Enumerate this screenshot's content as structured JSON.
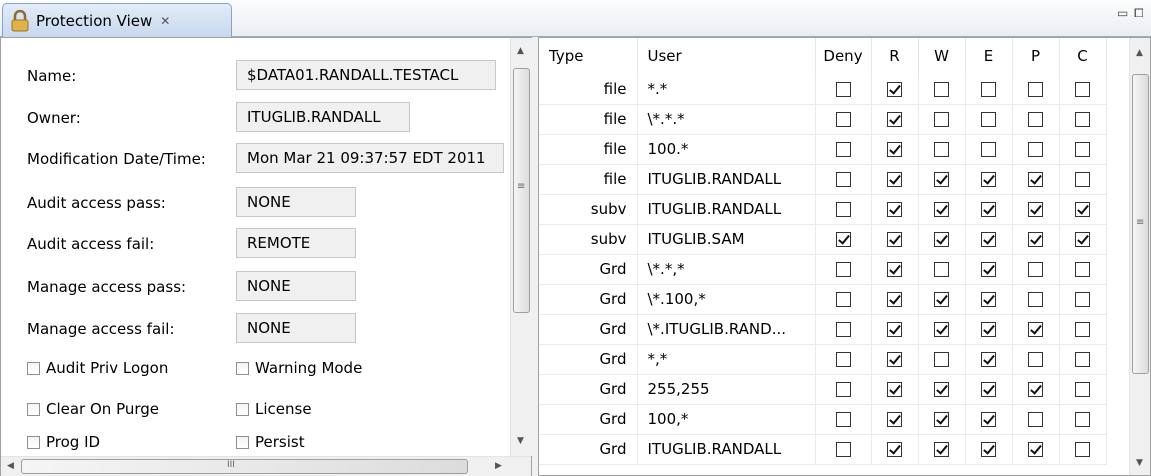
{
  "tab": {
    "title": "Protection View",
    "close": "✕"
  },
  "window_controls": {
    "minimize": "▭",
    "maximize": "⧠"
  },
  "fields": [
    {
      "label": "Name:",
      "value": "$DATA01.RANDALL.TESTACL"
    },
    {
      "label": "Owner:",
      "value": "ITUGLIB.RANDALL"
    },
    {
      "label": "Modification Date/Time:",
      "value": "Mon Mar 21 09:37:57 EDT 2011"
    },
    {
      "label": "Audit access pass:",
      "value": "NONE"
    },
    {
      "label": "Audit access fail:",
      "value": "REMOTE"
    },
    {
      "label": "Manage access pass:",
      "value": "NONE"
    },
    {
      "label": "Manage access fail:",
      "value": "NONE"
    }
  ],
  "options": [
    {
      "label": "Audit Priv Logon",
      "checked": false
    },
    {
      "label": "Warning Mode",
      "checked": false
    },
    {
      "label": "Clear On Purge",
      "checked": false
    },
    {
      "label": "License",
      "checked": false
    },
    {
      "label": "Prog ID",
      "checked": false
    },
    {
      "label": "Persist",
      "checked": false
    }
  ],
  "left_scroll": {
    "hscroll_grip": "III"
  },
  "table": {
    "columns": [
      "Type",
      "User",
      "Deny",
      "R",
      "W",
      "E",
      "P",
      "C"
    ],
    "rows": [
      {
        "type": "file",
        "user": "*.*",
        "flags": [
          0,
          1,
          0,
          0,
          0,
          0
        ]
      },
      {
        "type": "file",
        "user": "\\*.*.*",
        "flags": [
          0,
          1,
          0,
          0,
          0,
          0
        ]
      },
      {
        "type": "file",
        "user": "100.*",
        "flags": [
          0,
          1,
          0,
          0,
          0,
          0
        ]
      },
      {
        "type": "file",
        "user": "ITUGLIB.RANDALL",
        "flags": [
          0,
          1,
          1,
          1,
          1,
          0
        ]
      },
      {
        "type": "subv",
        "user": "ITUGLIB.RANDALL",
        "flags": [
          0,
          1,
          1,
          1,
          1,
          1
        ]
      },
      {
        "type": "subv",
        "user": "ITUGLIB.SAM",
        "flags": [
          1,
          1,
          1,
          1,
          1,
          1
        ]
      },
      {
        "type": "Grd",
        "user": "\\*.*,*",
        "flags": [
          0,
          1,
          0,
          1,
          0,
          0
        ]
      },
      {
        "type": "Grd",
        "user": "\\*.100,*",
        "flags": [
          0,
          1,
          1,
          1,
          0,
          0
        ]
      },
      {
        "type": "Grd",
        "user": "\\*.ITUGLIB.RAND...",
        "flags": [
          0,
          1,
          1,
          1,
          1,
          0
        ]
      },
      {
        "type": "Grd",
        "user": "*,*",
        "flags": [
          0,
          1,
          0,
          1,
          0,
          0
        ]
      },
      {
        "type": "Grd",
        "user": "255,255",
        "flags": [
          0,
          1,
          1,
          1,
          1,
          0
        ]
      },
      {
        "type": "Grd",
        "user": "100,*",
        "flags": [
          0,
          1,
          1,
          1,
          0,
          0
        ]
      },
      {
        "type": "Grd",
        "user": "ITUGLIB.RANDALL",
        "flags": [
          0,
          1,
          1,
          1,
          1,
          0
        ]
      }
    ]
  }
}
